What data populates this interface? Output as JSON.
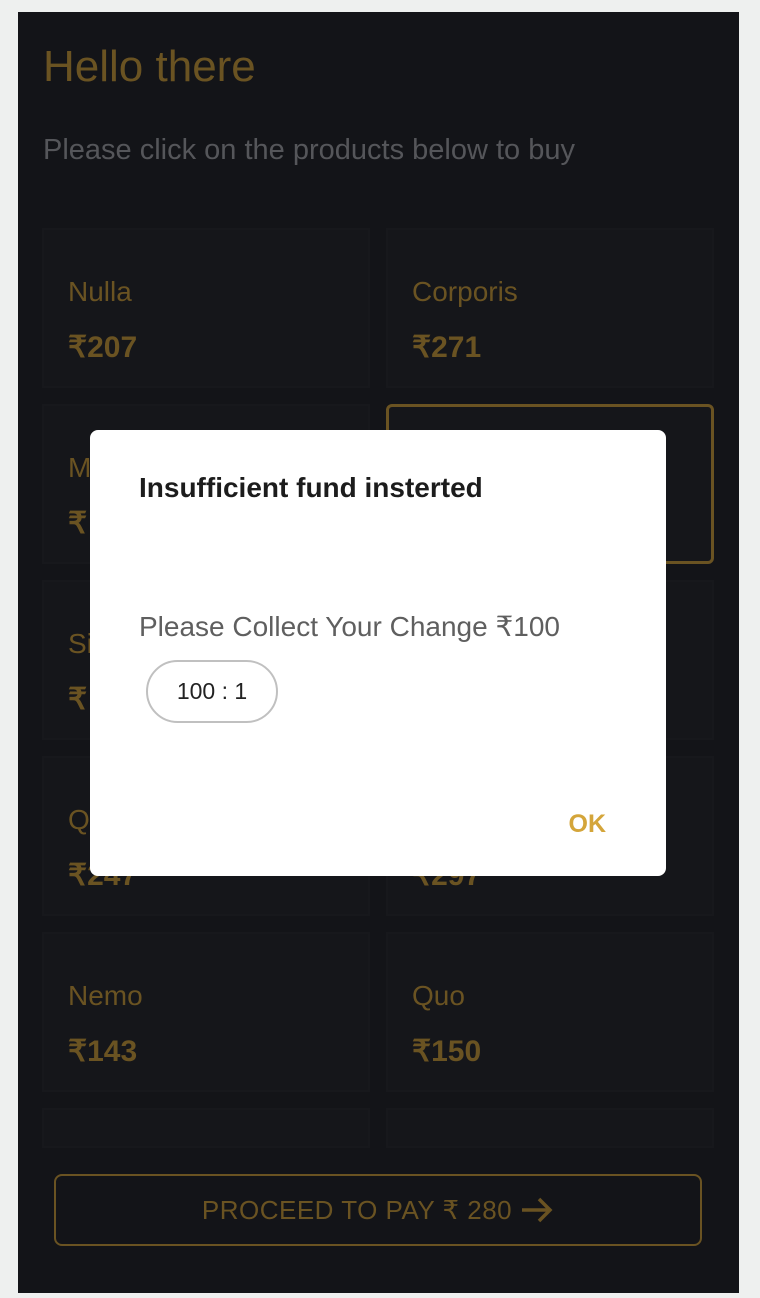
{
  "header": {
    "title": "Hello there",
    "subtitle": "Please click on the products below to buy"
  },
  "products": [
    {
      "name": "Nulla",
      "price": "₹207"
    },
    {
      "name": "Corporis",
      "price": "₹271"
    },
    {
      "name": "M",
      "price": "₹"
    },
    {
      "name": "",
      "price": "",
      "selected": true
    },
    {
      "name": "Si",
      "price": "₹"
    },
    {
      "name": "",
      "price": ""
    },
    {
      "name": "Q",
      "price": "₹247"
    },
    {
      "name": "",
      "price": "₹297"
    },
    {
      "name": "Nemo",
      "price": "₹143"
    },
    {
      "name": "Quo",
      "price": "₹150"
    },
    {
      "name": "",
      "price": ""
    },
    {
      "name": "",
      "price": ""
    }
  ],
  "pay_button": {
    "label": "PROCEED TO PAY ₹ 280",
    "icon": "arrow-right-icon"
  },
  "dialog": {
    "title": "Insufficient fund insterted",
    "message": "Please Collect Your Change ₹100",
    "chip": "100 : 1",
    "ok": "OK"
  },
  "colors": {
    "accent": "#d4a53a",
    "background": "#131418"
  }
}
